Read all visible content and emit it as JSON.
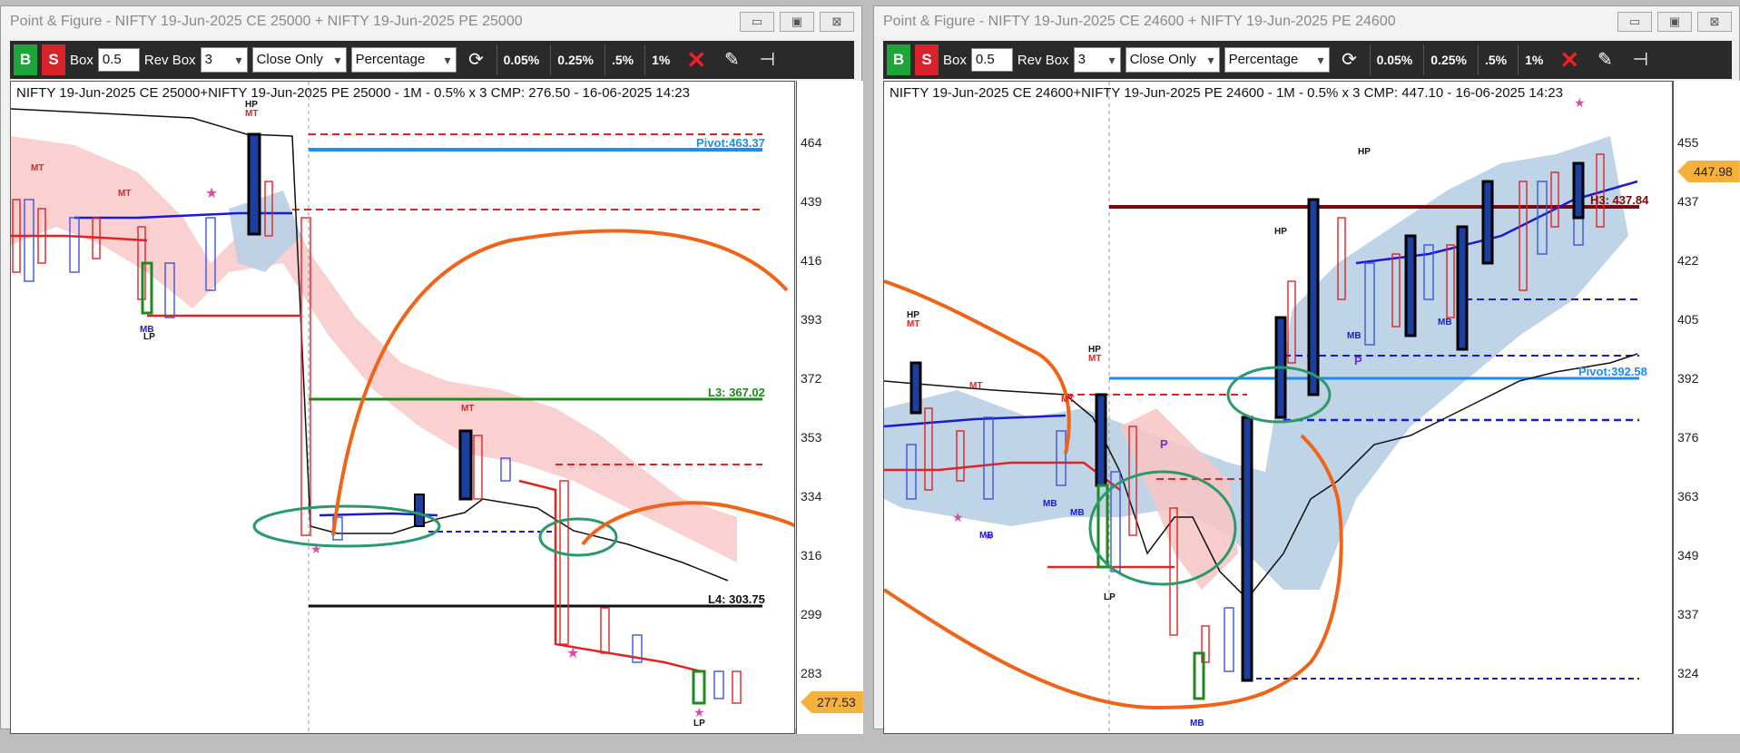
{
  "left": {
    "window_title": "Point & Figure - NIFTY 19-Jun-2025 CE 25000 + NIFTY 19-Jun-2025 PE 25000",
    "toolbar": {
      "buy": "B",
      "sell": "S",
      "box_label": "Box",
      "box_value": "0.5",
      "rev_label": "Rev Box",
      "rev_value": "3",
      "method": "Close Only",
      "scale": "Percentage",
      "p1": "0.05%",
      "p2": "0.25%",
      "p3": ".5%",
      "p4": "1%"
    },
    "chart_title": "NIFTY 19-Jun-2025 CE 25000+NIFTY 19-Jun-2025 PE 25000 - 1M - 0.5% x 3 CMP: 276.50 - 16-06-2025 14:23",
    "y_ticks": [
      "464",
      "439",
      "416",
      "393",
      "372",
      "353",
      "334",
      "316",
      "299",
      "283"
    ],
    "cmp_tag": "277.53",
    "levels": {
      "pivot": "Pivot:463.37",
      "l3": "L3: 367.02",
      "l4": "L4: 303.75"
    },
    "markers": {
      "hp": "HP",
      "mt": "MT",
      "mb": "MB",
      "lp": "LP"
    },
    "colors": {
      "pivot": "#1e8cf0",
      "l3": "#1f8a1f",
      "l4": "#111111"
    }
  },
  "right": {
    "window_title": "Point & Figure - NIFTY 19-Jun-2025 CE 24600 + NIFTY 19-Jun-2025 PE 24600",
    "toolbar": {
      "buy": "B",
      "sell": "S",
      "box_label": "Box",
      "box_value": "0.5",
      "rev_label": "Rev Box",
      "rev_value": "3",
      "method": "Close Only",
      "scale": "Percentage",
      "p1": "0.05%",
      "p2": "0.25%",
      "p3": ".5%",
      "p4": "1%"
    },
    "chart_title": "NIFTY 19-Jun-2025 CE 24600+NIFTY 19-Jun-2025 PE 24600 - 1M - 0.5% x 3 CMP: 447.10 - 16-06-2025 14:23",
    "y_ticks": [
      "455",
      "437",
      "422",
      "405",
      "392",
      "376",
      "363",
      "349",
      "337",
      "324"
    ],
    "cmp_tag": "447.98",
    "levels": {
      "pivot": "Pivot:392.58",
      "h3": "H3: 437.84"
    },
    "markers": {
      "hp": "HP",
      "mt": "MT",
      "mb": "MB",
      "lp": "LP",
      "p": "P"
    },
    "colors": {
      "pivot": "#1e8cf0",
      "h3": "#7a0a0a"
    }
  },
  "window_buttons": {
    "minimize": "▭",
    "restore": "▣",
    "close": "⊠"
  }
}
